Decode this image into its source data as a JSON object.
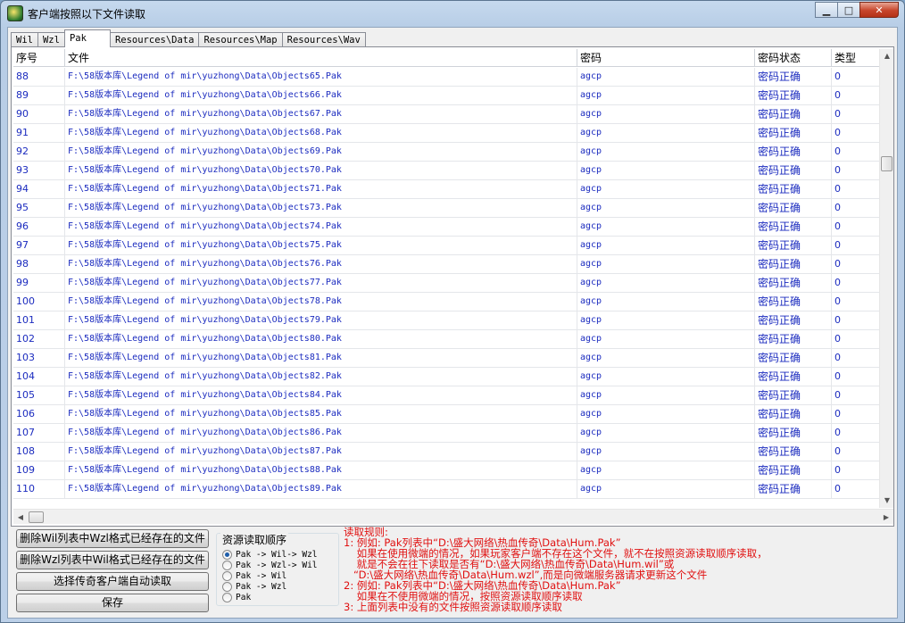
{
  "window": {
    "title": "客户端按照以下文件读取",
    "minimize": "▁",
    "maximize": "□",
    "close": "✕"
  },
  "tabs": [
    {
      "label": "Wil",
      "active": false
    },
    {
      "label": "Wzl",
      "active": false
    },
    {
      "label": "Pak",
      "active": true
    },
    {
      "label": "Resources\\Data",
      "active": false
    },
    {
      "label": "Resources\\Map",
      "active": false
    },
    {
      "label": "Resources\\Wav",
      "active": false
    }
  ],
  "table": {
    "headers": [
      "序号",
      "文件",
      "密码",
      "密码状态",
      "类型"
    ],
    "rows": [
      {
        "no": "88",
        "file": "F:\\58版本库\\Legend of mir\\yuzhong\\Data\\Objects65.Pak",
        "password": "agcp",
        "status": "密码正确",
        "type": "0"
      },
      {
        "no": "89",
        "file": "F:\\58版本库\\Legend of mir\\yuzhong\\Data\\Objects66.Pak",
        "password": "agcp",
        "status": "密码正确",
        "type": "0"
      },
      {
        "no": "90",
        "file": "F:\\58版本库\\Legend of mir\\yuzhong\\Data\\Objects67.Pak",
        "password": "agcp",
        "status": "密码正确",
        "type": "0"
      },
      {
        "no": "91",
        "file": "F:\\58版本库\\Legend of mir\\yuzhong\\Data\\Objects68.Pak",
        "password": "agcp",
        "status": "密码正确",
        "type": "0"
      },
      {
        "no": "92",
        "file": "F:\\58版本库\\Legend of mir\\yuzhong\\Data\\Objects69.Pak",
        "password": "agcp",
        "status": "密码正确",
        "type": "0"
      },
      {
        "no": "93",
        "file": "F:\\58版本库\\Legend of mir\\yuzhong\\Data\\Objects70.Pak",
        "password": "agcp",
        "status": "密码正确",
        "type": "0"
      },
      {
        "no": "94",
        "file": "F:\\58版本库\\Legend of mir\\yuzhong\\Data\\Objects71.Pak",
        "password": "agcp",
        "status": "密码正确",
        "type": "0"
      },
      {
        "no": "95",
        "file": "F:\\58版本库\\Legend of mir\\yuzhong\\Data\\Objects73.Pak",
        "password": "agcp",
        "status": "密码正确",
        "type": "0"
      },
      {
        "no": "96",
        "file": "F:\\58版本库\\Legend of mir\\yuzhong\\Data\\Objects74.Pak",
        "password": "agcp",
        "status": "密码正确",
        "type": "0"
      },
      {
        "no": "97",
        "file": "F:\\58版本库\\Legend of mir\\yuzhong\\Data\\Objects75.Pak",
        "password": "agcp",
        "status": "密码正确",
        "type": "0"
      },
      {
        "no": "98",
        "file": "F:\\58版本库\\Legend of mir\\yuzhong\\Data\\Objects76.Pak",
        "password": "agcp",
        "status": "密码正确",
        "type": "0"
      },
      {
        "no": "99",
        "file": "F:\\58版本库\\Legend of mir\\yuzhong\\Data\\Objects77.Pak",
        "password": "agcp",
        "status": "密码正确",
        "type": "0"
      },
      {
        "no": "100",
        "file": "F:\\58版本库\\Legend of mir\\yuzhong\\Data\\Objects78.Pak",
        "password": "agcp",
        "status": "密码正确",
        "type": "0"
      },
      {
        "no": "101",
        "file": "F:\\58版本库\\Legend of mir\\yuzhong\\Data\\Objects79.Pak",
        "password": "agcp",
        "status": "密码正确",
        "type": "0"
      },
      {
        "no": "102",
        "file": "F:\\58版本库\\Legend of mir\\yuzhong\\Data\\Objects80.Pak",
        "password": "agcp",
        "status": "密码正确",
        "type": "0"
      },
      {
        "no": "103",
        "file": "F:\\58版本库\\Legend of mir\\yuzhong\\Data\\Objects81.Pak",
        "password": "agcp",
        "status": "密码正确",
        "type": "0"
      },
      {
        "no": "104",
        "file": "F:\\58版本库\\Legend of mir\\yuzhong\\Data\\Objects82.Pak",
        "password": "agcp",
        "status": "密码正确",
        "type": "0"
      },
      {
        "no": "105",
        "file": "F:\\58版本库\\Legend of mir\\yuzhong\\Data\\Objects84.Pak",
        "password": "agcp",
        "status": "密码正确",
        "type": "0"
      },
      {
        "no": "106",
        "file": "F:\\58版本库\\Legend of mir\\yuzhong\\Data\\Objects85.Pak",
        "password": "agcp",
        "status": "密码正确",
        "type": "0"
      },
      {
        "no": "107",
        "file": "F:\\58版本库\\Legend of mir\\yuzhong\\Data\\Objects86.Pak",
        "password": "agcp",
        "status": "密码正确",
        "type": "0"
      },
      {
        "no": "108",
        "file": "F:\\58版本库\\Legend of mir\\yuzhong\\Data\\Objects87.Pak",
        "password": "agcp",
        "status": "密码正确",
        "type": "0"
      },
      {
        "no": "109",
        "file": "F:\\58版本库\\Legend of mir\\yuzhong\\Data\\Objects88.Pak",
        "password": "agcp",
        "status": "密码正确",
        "type": "0"
      },
      {
        "no": "110",
        "file": "F:\\58版本库\\Legend of mir\\yuzhong\\Data\\Objects89.Pak",
        "password": "agcp",
        "status": "密码正确",
        "type": "0"
      }
    ]
  },
  "scrollbars": {
    "up": "▲",
    "down": "▼",
    "left": "◀",
    "right": "▶"
  },
  "buttons": {
    "delete_wil": "删除Wil列表中Wzl格式已经存在的文件",
    "delete_wzl": "删除Wzl列表中Wil格式已经存在的文件",
    "select_client": "选择传奇客户端自动读取",
    "save": "保存"
  },
  "order": {
    "title": "资源读取顺序",
    "options": [
      {
        "label": "Pak -> Wil-> Wzl",
        "checked": true
      },
      {
        "label": "Pak -> Wzl-> Wil",
        "checked": false
      },
      {
        "label": "Pak -> Wil",
        "checked": false
      },
      {
        "label": "Pak -> Wzl",
        "checked": false
      },
      {
        "label": "Pak",
        "checked": false
      }
    ]
  },
  "rules": {
    "lines": [
      "读取规则:",
      "1: 例如: Pak列表中“D:\\盛大网络\\热血传奇\\Data\\Hum.Pak”",
      "    如果在使用微端的情况，如果玩家客户端不存在这个文件，就不在按照资源读取顺序读取，",
      "    就是不会在往下读取是否有“D:\\盛大网络\\热血传奇\\Data\\Hum.wil”或",
      "   “D:\\盛大网络\\热血传奇\\Data\\Hum.wzl”,而是向微端服务器请求更新这个文件",
      "2: 例如: Pak列表中“D:\\盛大网络\\热血传奇\\Data\\Hum.Pak”",
      "    如果在不使用微端的情况，按照资源读取顺序读取",
      "3: 上面列表中没有的文件按照资源读取顺序读取"
    ]
  },
  "colors": {
    "accent_text": "#1b2bbf",
    "rules_text": "#e01010"
  }
}
